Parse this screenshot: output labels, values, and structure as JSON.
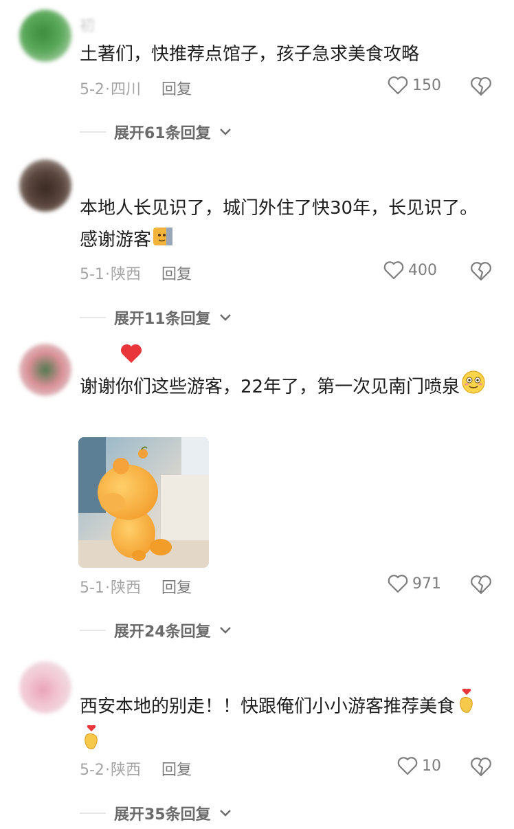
{
  "comments": [
    {
      "username": "初",
      "text": "土著们，快推荐点馆子，孩子急求美食攻略",
      "date": "5-2",
      "location": "四川",
      "reply_label": "回复",
      "likes": "150",
      "expand_text": "展开61条回复"
    },
    {
      "username": "",
      "text": "本地人长见识了，城门外住了快30年，长见识了。感谢游客",
      "date": "5-1",
      "location": "陕西",
      "reply_label": "回复",
      "likes": "400",
      "expand_text": "展开11条回复"
    },
    {
      "username": "",
      "text": "谢谢你们这些游客，22年了，第一次见南门喷泉",
      "date": "5-1",
      "location": "陕西",
      "reply_label": "回复",
      "likes": "971",
      "expand_text": "展开24条回复"
    },
    {
      "username": "",
      "text": "西安本地的别走！！快跟俺们小小游客推荐美食",
      "date": "5-2",
      "location": "陕西",
      "reply_label": "回复",
      "likes": "10",
      "expand_text": "展开35条回复"
    }
  ],
  "icons": {
    "like": "heart-outline-icon",
    "dislike": "broken-heart-icon",
    "expand": "chevron-down-icon"
  },
  "colors": {
    "text": "#1e1e1e",
    "meta": "#a4a4a4",
    "expand": "#6a6a6a"
  }
}
